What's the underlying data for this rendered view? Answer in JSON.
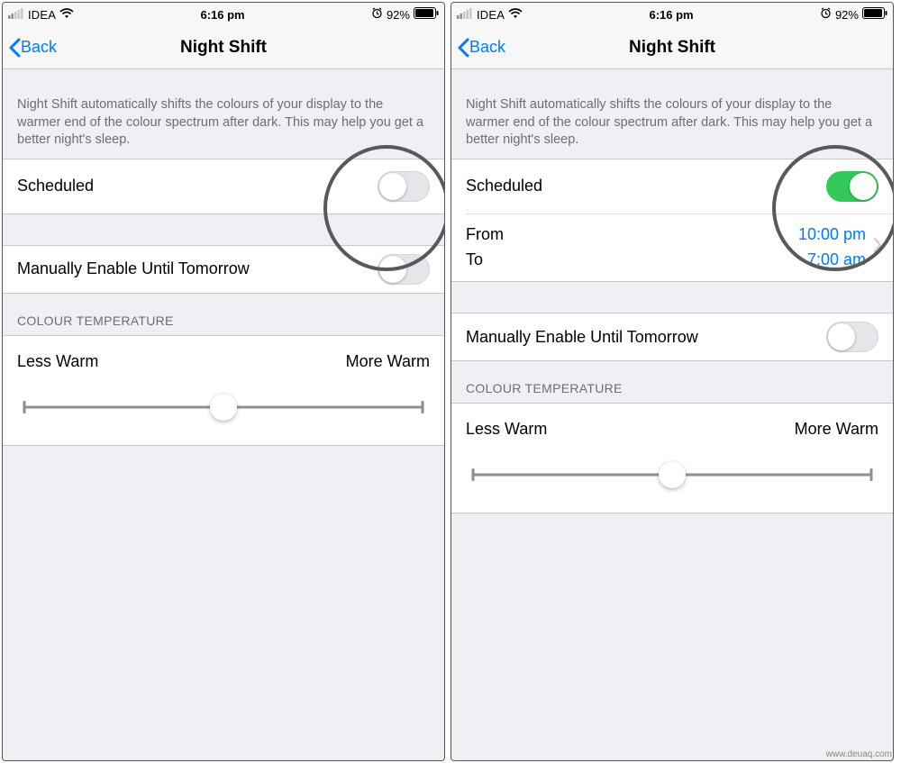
{
  "status": {
    "carrier": "IDEA",
    "time": "6:16 pm",
    "battery": "92%"
  },
  "nav": {
    "back": "Back",
    "title": "Night Shift"
  },
  "description": "Night Shift automatically shifts the colours of your display to the warmer end of the colour spectrum after dark. This may help you get a better night's sleep.",
  "rows": {
    "scheduled": "Scheduled",
    "manual": "Manually Enable Until Tomorrow"
  },
  "schedule": {
    "from_label": "From",
    "to_label": "To",
    "from_value": "10:00 pm",
    "to_value": "7:00 am"
  },
  "temperature": {
    "header": "COLOUR TEMPERATURE",
    "less": "Less Warm",
    "more": "More Warm"
  },
  "watermark": "www.deuaq.com"
}
